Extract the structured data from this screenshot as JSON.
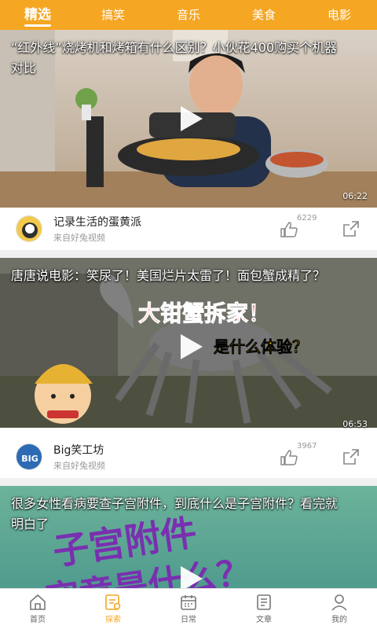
{
  "tabs": [
    "精选",
    "搞笑",
    "音乐",
    "美食",
    "电影"
  ],
  "feed": [
    {
      "title": "“红外线”烧烤机和烤箱有什么区别？小伙花400购买个机器对比",
      "duration": "06:22",
      "author": "记录生活的蛋黄派",
      "source": "来自好兔视频",
      "likes": "6229"
    },
    {
      "title": "唐唐说电影：笑尿了！美国烂片太雷了！面包蟹成精了？",
      "duration": "06:53",
      "author": "Big笑工坊",
      "source": "来自好兔视频",
      "likes": "3967",
      "thumb_text1": "大钳蟹拆家！",
      "thumb_text2": "是什么体验？"
    },
    {
      "title": "很多女性看病要查子宫附件，到底什么是子宫附件？看完就明白了",
      "thumb_text1": "子宫附件",
      "thumb_text2": "究竟是什么？"
    }
  ],
  "avatar2_text": "BIG",
  "bottom_nav": [
    {
      "label": "首页",
      "icon": "home-icon"
    },
    {
      "label": "探索",
      "icon": "explore-icon"
    },
    {
      "label": "日常",
      "icon": "calendar-icon"
    },
    {
      "label": "文章",
      "icon": "article-icon"
    },
    {
      "label": "我的",
      "icon": "profile-icon"
    }
  ],
  "colors": {
    "accent": "#f5a623",
    "active_nav": "#f5a623"
  }
}
